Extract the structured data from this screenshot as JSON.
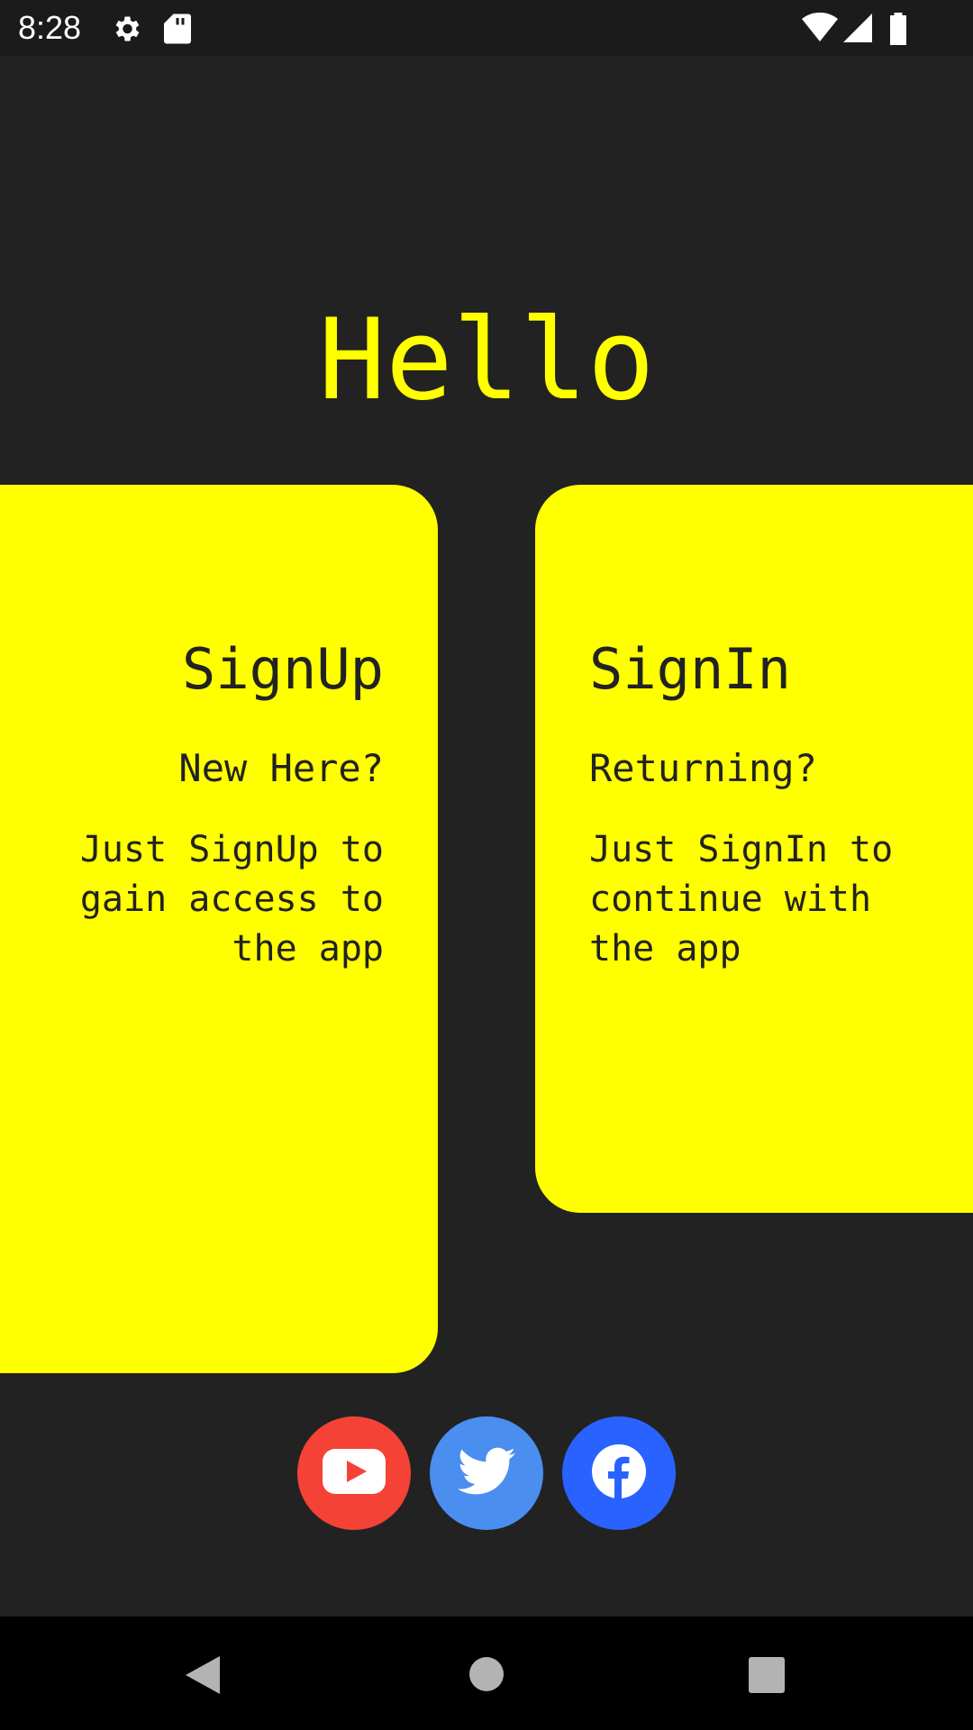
{
  "status_bar": {
    "time": "8:28",
    "icons": [
      "settings-icon",
      "sd-card-icon",
      "wifi-icon",
      "signal-icon",
      "battery-icon"
    ]
  },
  "greeting": "Hello",
  "cards": {
    "signup": {
      "title": "SignUp",
      "subtitle": "New Here?",
      "body": "Just SignUp to\ngain access to\nthe app"
    },
    "signin": {
      "title": "SignIn",
      "subtitle": "Returning?",
      "body": "Just SignIn to\ncontinue with\nthe app"
    }
  },
  "social": [
    {
      "name": "youtube-icon",
      "color": "#f44336"
    },
    {
      "name": "twitter-icon",
      "color": "#4a8ef0"
    },
    {
      "name": "facebook-icon",
      "color": "#2962ff"
    }
  ],
  "nav": [
    "back-icon",
    "home-icon",
    "recents-icon"
  ],
  "colors": {
    "accent": "#ffff00",
    "background": "#222223"
  }
}
